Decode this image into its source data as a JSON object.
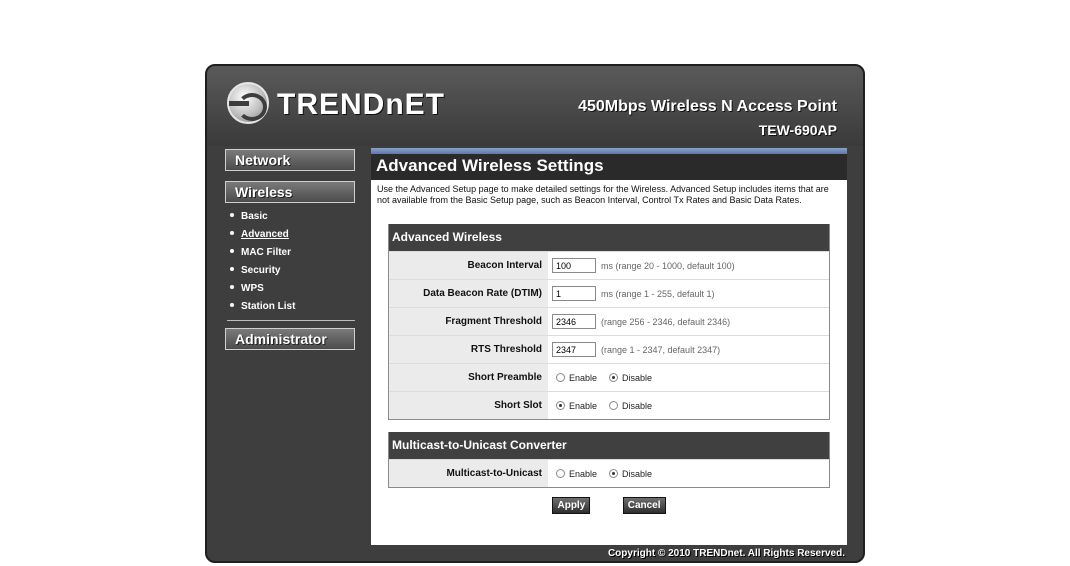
{
  "header": {
    "logo_text": "TRENDnET",
    "product_name": "450Mbps Wireless N Access Point",
    "model": "TEW-690AP"
  },
  "nav": {
    "network": "Network",
    "wireless": "Wireless",
    "administrator": "Administrator",
    "wireless_items": [
      {
        "label": "Basic"
      },
      {
        "label": "Advanced"
      },
      {
        "label": "MAC Filter"
      },
      {
        "label": "Security"
      },
      {
        "label": "WPS"
      },
      {
        "label": "Station List"
      }
    ]
  },
  "page": {
    "title": "Advanced Wireless Settings",
    "intro": "Use the Advanced Setup page to make detailed settings for the Wireless. Advanced Setup includes items that are not available from the Basic Setup page, such as Beacon Interval, Control Tx Rates and Basic Data Rates."
  },
  "advanced": {
    "heading": "Advanced Wireless",
    "beacon_label": "Beacon Interval",
    "beacon_value": "100",
    "beacon_hint": "ms (range 20 - 1000, default 100)",
    "dtim_label": "Data Beacon Rate (DTIM)",
    "dtim_value": "1",
    "dtim_hint": "ms (range 1 - 255, default 1)",
    "frag_label": "Fragment Threshold",
    "frag_value": "2346",
    "frag_hint": "(range 256 - 2346, default 2346)",
    "rts_label": "RTS Threshold",
    "rts_value": "2347",
    "rts_hint": "(range 1 - 2347, default 2347)",
    "preamble_label": "Short Preamble",
    "slot_label": "Short Slot",
    "enable": "Enable",
    "disable": "Disable"
  },
  "multicast": {
    "heading": "Multicast-to-Unicast Converter",
    "label": "Multicast-to-Unicast",
    "enable": "Enable",
    "disable": "Disable"
  },
  "buttons": {
    "apply": "Apply",
    "cancel": "Cancel"
  },
  "footer": "Copyright © 2010 TRENDnet. All Rights Reserved."
}
